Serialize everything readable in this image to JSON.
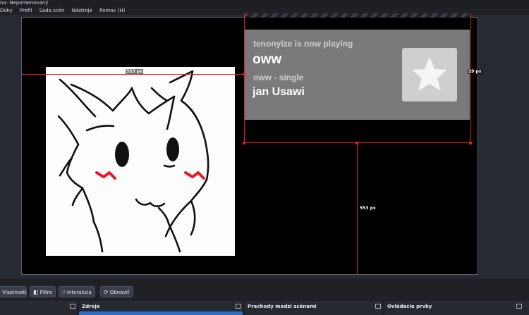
{
  "window": {
    "title": "na: Nepomenovaný"
  },
  "menu": [
    {
      "label": "Doky"
    },
    {
      "label": "Profil"
    },
    {
      "label": "Sada scén"
    },
    {
      "label": "Nástroje"
    },
    {
      "label": "Pomoc (H)"
    }
  ],
  "canvas": {
    "now_playing": {
      "status": "tenonyize is now playing",
      "title": "oww",
      "album": "oww - single",
      "artist": "jan Usawi",
      "art_icon": "star-icon"
    },
    "guides": {
      "left_distance": "553 px",
      "right_distance": "29 px",
      "bottom_distance": "553 px"
    }
  },
  "toolbar": {
    "properties": "Vlastnosti",
    "filters": "Filtre",
    "interact": "Interakcia",
    "refresh": "Obnoviť"
  },
  "docks": {
    "sources": "Zdroje",
    "transitions": "Prechody medzi scénami",
    "controls": "Ovládacie prvky"
  },
  "colors": {
    "accent_red": "#e01f1f",
    "selection_blue": "#2b6ecf",
    "canvas_bg": "#000000",
    "widget_gray": "#7a7a7a"
  }
}
